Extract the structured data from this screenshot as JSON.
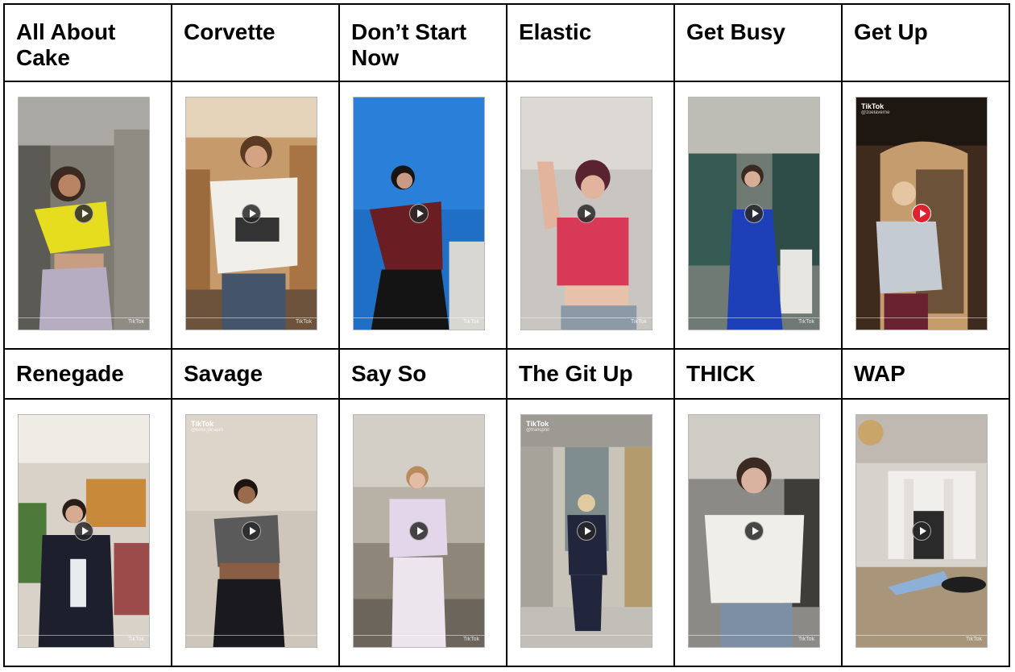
{
  "table": {
    "rows": [
      {
        "cells": [
          {
            "title": "All About Cake",
            "video": {
              "play_style": "default"
            }
          },
          {
            "title": "Corvette",
            "video": {
              "play_style": "default"
            }
          },
          {
            "title": "Don’t Start Now",
            "video": {
              "play_style": "default"
            }
          },
          {
            "title": "Elastic",
            "video": {
              "play_style": "default"
            }
          },
          {
            "title": "Get Busy",
            "video": {
              "play_style": "default"
            }
          },
          {
            "title": "Get Up",
            "video": {
              "play_style": "red",
              "watermark": "TikTok"
            }
          }
        ]
      },
      {
        "cells": [
          {
            "title": "Renegade",
            "video": {
              "play_style": "default"
            }
          },
          {
            "title": "Savage",
            "video": {
              "play_style": "default",
              "watermark": "TikTok"
            }
          },
          {
            "title": "Say So",
            "video": {
              "play_style": "default"
            }
          },
          {
            "title": "The Git Up",
            "video": {
              "play_style": "default",
              "watermark": "TikTok"
            }
          },
          {
            "title": "THICK",
            "video": {
              "play_style": "default"
            }
          },
          {
            "title": "WAP",
            "video": {
              "play_style": "default"
            }
          }
        ]
      }
    ]
  },
  "colors": {
    "grid_line": "#000000",
    "play_default": "#282828",
    "play_red": "#e0202e"
  }
}
